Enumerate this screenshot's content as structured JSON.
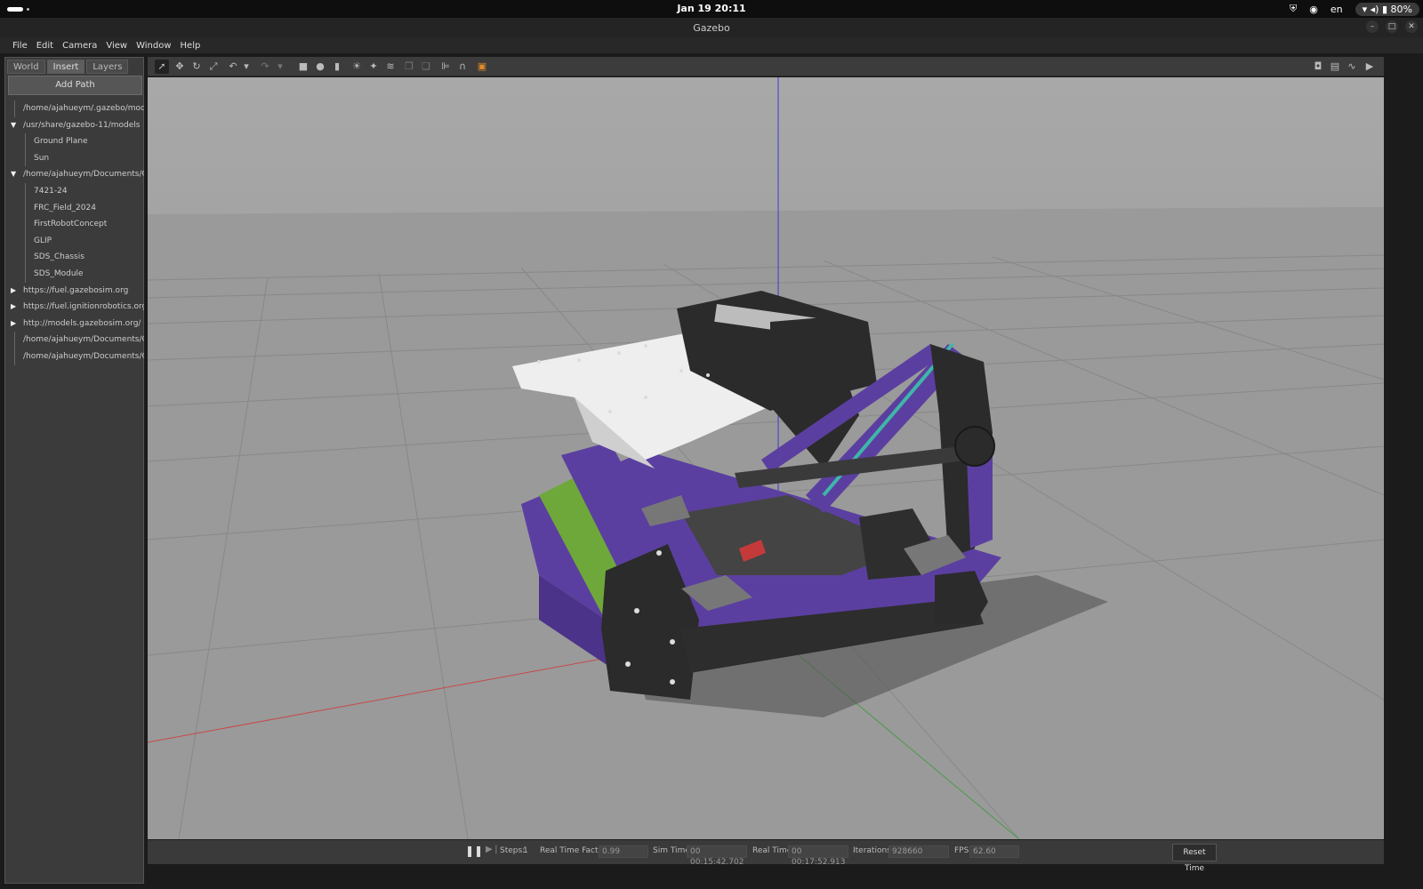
{
  "system": {
    "clock": "Jan 19  20:11",
    "language": "en",
    "battery": "80%"
  },
  "window": {
    "title": "Gazebo"
  },
  "menu": [
    "File",
    "Edit",
    "Camera",
    "View",
    "Window",
    "Help"
  ],
  "left_panel": {
    "tabs": [
      "World",
      "Insert",
      "Layers"
    ],
    "active_tab": "Insert",
    "add_path_label": "Add Path",
    "tree": [
      {
        "label": "/home/ajahueym/.gazebo/models",
        "level": 0,
        "expanded": null
      },
      {
        "label": "/usr/share/gazebo-11/models",
        "level": 0,
        "expanded": true
      },
      {
        "label": "Ground Plane",
        "level": 1
      },
      {
        "label": "Sun",
        "level": 1
      },
      {
        "label": "/home/ajahueym/Documents/Gi...",
        "level": 0,
        "expanded": true
      },
      {
        "label": "7421-24",
        "level": 1
      },
      {
        "label": "FRC_Field_2024",
        "level": 1
      },
      {
        "label": "FirstRobotConcept",
        "level": 1
      },
      {
        "label": "GLIP",
        "level": 1
      },
      {
        "label": "SDS_Chassis",
        "level": 1
      },
      {
        "label": "SDS_Module",
        "level": 1
      },
      {
        "label": "https://fuel.gazebosim.org",
        "level": 0,
        "expanded": false
      },
      {
        "label": "https://fuel.ignitionrobotics.org",
        "level": 0,
        "expanded": false
      },
      {
        "label": "http://models.gazebosim.org/",
        "level": 0,
        "expanded": false
      },
      {
        "label": "/home/ajahueym/Documents/Gi...",
        "level": 0,
        "expanded": null
      },
      {
        "label": "/home/ajahueym/Documents/Gi...",
        "level": 0,
        "expanded": null
      }
    ]
  },
  "toolbar": {
    "tools": [
      "select-tool-icon",
      "translate-tool-icon",
      "rotate-tool-icon",
      "scale-tool-icon",
      "undo-icon",
      "undo-dropdown-icon",
      "redo-icon",
      "redo-dropdown-icon",
      "box-shape-icon",
      "sphere-shape-icon",
      "cylinder-shape-icon",
      "point-light-icon",
      "spot-light-icon",
      "directional-light-icon",
      "copy-icon",
      "paste-icon",
      "align-icon",
      "snap-icon",
      "change-view-icon"
    ],
    "right_tools": [
      "screenshot-icon",
      "log-icon",
      "plot-icon",
      "video-icon"
    ]
  },
  "status": {
    "steps_label": "Steps:",
    "steps_value": "1",
    "rtf_label": "Real Time Factor:",
    "rtf_value": "0.99",
    "sim_time_label": "Sim Time:",
    "sim_time_value": "00 00:15:42.702",
    "real_time_label": "Real Time:",
    "real_time_value": "00 00:17:52.913",
    "iterations_label": "Iterations:",
    "iterations_value": "928660",
    "fps_label": "FPS:",
    "fps_value": "62.60",
    "reset_label": "Reset Time"
  },
  "colors": {
    "robot_frame": "#5b3fa0",
    "robot_dark": "#2b2b2b",
    "intake_green": "#6fa83a",
    "accent_teal": "#3fb6a8",
    "ground": "#9b9b9b",
    "sky": "#a9a9a9"
  }
}
